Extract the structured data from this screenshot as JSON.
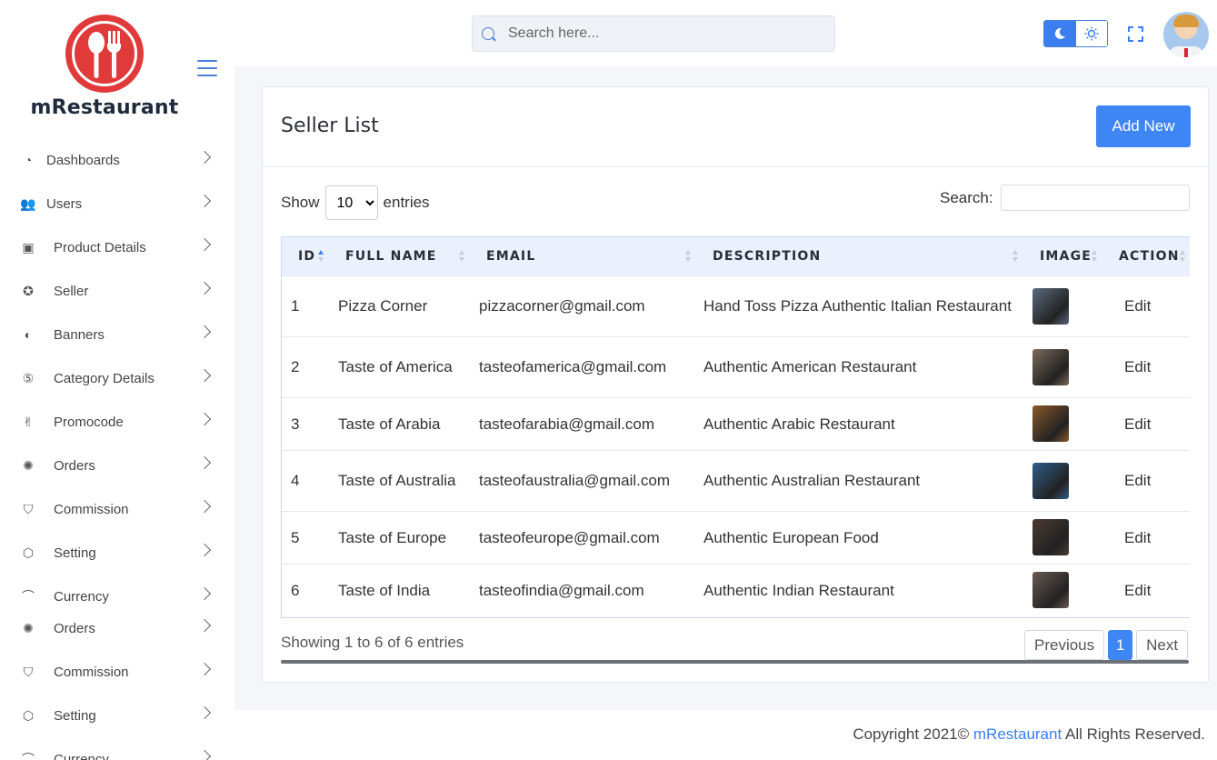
{
  "app": {
    "brand": "mRestaurant",
    "search_placeholder": "Search here..."
  },
  "sidebar": {
    "items": [
      {
        "label": "Dashboards",
        "icon": "dashboard-icon"
      },
      {
        "label": "Users",
        "icon": "users-icon"
      },
      {
        "label": "Product Details",
        "icon": "product-icon"
      },
      {
        "label": "Seller",
        "icon": "seller-icon"
      },
      {
        "label": "Banners",
        "icon": "banner-icon"
      },
      {
        "label": "Category Details",
        "icon": "category-icon"
      },
      {
        "label": "Promocode",
        "icon": "promocode-icon"
      },
      {
        "label": "Orders",
        "icon": "orders-icon"
      },
      {
        "label": "Commission",
        "icon": "commission-icon"
      },
      {
        "label": "Setting",
        "icon": "setting-icon"
      },
      {
        "label": "Currency",
        "icon": "currency-icon"
      },
      {
        "label": "Orders",
        "icon": "orders-icon"
      },
      {
        "label": "Commission",
        "icon": "commission-icon"
      },
      {
        "label": "Setting",
        "icon": "setting-icon"
      },
      {
        "label": "Currency",
        "icon": "currency-icon"
      }
    ]
  },
  "card": {
    "title": "Seller List",
    "add_button": "Add New"
  },
  "table_controls": {
    "show_label": "Show",
    "entries_label": "entries",
    "page_size": "10",
    "search_label": "Search:"
  },
  "table": {
    "columns": [
      "ID",
      "FULL NAME",
      "EMAIL",
      "DESCRIPTION",
      "IMAGE",
      "ACTION"
    ],
    "rows": [
      {
        "id": "1",
        "name": "Pizza Corner",
        "email": "pizzacorner@gmail.com",
        "description": "Hand Toss Pizza Authentic Italian Restaurant",
        "action": "Edit",
        "thumb_color": "#5b6a80"
      },
      {
        "id": "2",
        "name": "Taste of America",
        "email": "tasteofamerica@gmail.com",
        "description": "Authentic American Restaurant",
        "action": "Edit",
        "thumb_color": "#7a6a5a"
      },
      {
        "id": "3",
        "name": "Taste of Arabia",
        "email": "tasteofarabia@gmail.com",
        "description": "Authentic Arabic Restaurant",
        "action": "Edit",
        "thumb_color": "#8a5a2a"
      },
      {
        "id": "4",
        "name": "Taste of Australia",
        "email": "tasteofaustralia@gmail.com",
        "description": "Authentic Australian Restaurant",
        "action": "Edit",
        "thumb_color": "#2f5d8a"
      },
      {
        "id": "5",
        "name": "Taste of Europe",
        "email": "tasteofeurope@gmail.com",
        "description": "Authentic European Food",
        "action": "Edit",
        "thumb_color": "#4a3a30"
      },
      {
        "id": "6",
        "name": "Taste of India",
        "email": "tasteofindia@gmail.com",
        "description": "Authentic Indian Restaurant",
        "action": "Edit",
        "thumb_color": "#6a5a52"
      }
    ]
  },
  "pagination": {
    "info": "Showing 1 to 6 of 6 entries",
    "previous": "Previous",
    "current": "1",
    "next": "Next"
  },
  "footer": {
    "prefix": "Copyright 2021© ",
    "brand": "mRestaurant",
    "suffix": " All Rights Reserved."
  },
  "colors": {
    "accent": "#3f86f5",
    "logo_red": "#e03a3a"
  }
}
